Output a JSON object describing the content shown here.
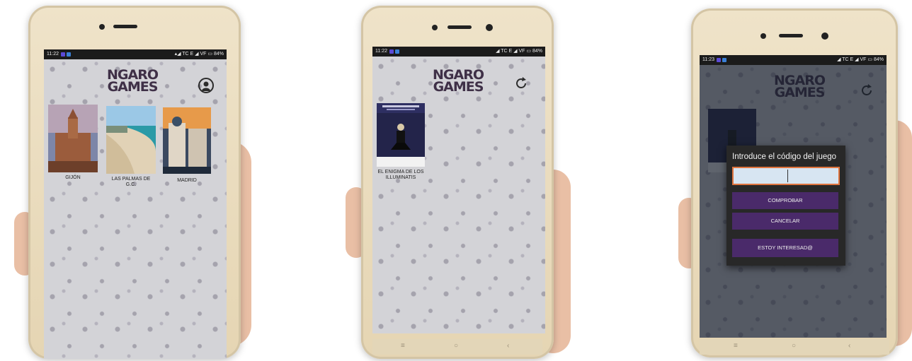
{
  "colors": {
    "brand_purple": "#3f3047",
    "button_purple": "#4a2a6a",
    "input_border": "#e0743e",
    "phone_gold": "#e5d5b3"
  },
  "status_bar": {
    "screen1_time": "11:22",
    "screen2_time": "11:22",
    "screen3_time": "11:23",
    "carrier": "TC E",
    "operator": "VF",
    "battery": "84%"
  },
  "brand": {
    "line1": "NGARO",
    "line2": "GAMES"
  },
  "screen1": {
    "games": [
      {
        "label": "GIJÓN"
      },
      {
        "label": "LAS PALMAS DE G.C."
      },
      {
        "label": "MADRID"
      }
    ],
    "profile_icon": "user-profile-icon"
  },
  "screen2": {
    "game": {
      "label": "EL ENIGMA DE LOS ILLUMINATIS"
    },
    "refresh_icon": "refresh-icon"
  },
  "screen3": {
    "dialog": {
      "title": "Introduce el código del juego",
      "input_value": "",
      "check_button": "COMPROBAR",
      "cancel_button": "CANCELAR",
      "interested_button": "ESTOY INTERESAD@"
    },
    "refresh_icon": "refresh-icon"
  },
  "android_nav": {
    "back": "≡",
    "home": "○",
    "recent": "‹"
  }
}
